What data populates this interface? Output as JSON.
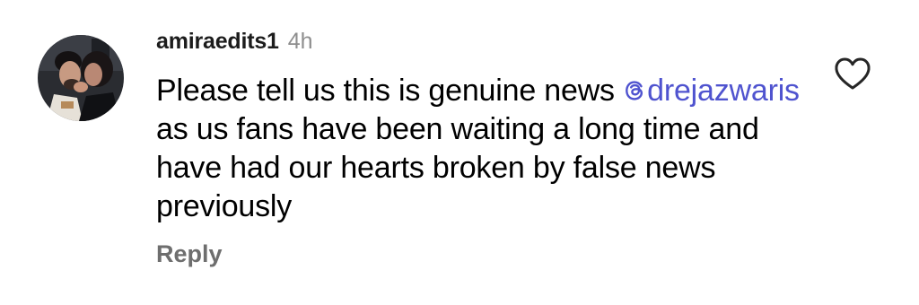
{
  "comment": {
    "username": "amiraedits1",
    "time": "4h",
    "text_before_mention": "Please tell us this is genuine news ",
    "mention": "drejazwaris",
    "text_after_mention": " as us fans have been waiting a long time and have had our hearts broken by false news previously",
    "reply_label": "Reply",
    "avatar_icon": "avatar",
    "like_icon": "heart-outline-icon",
    "mention_icon": "threads-at-icon"
  },
  "colors": {
    "mention": "#4f53cf",
    "time": "#8e8e8e",
    "reply": "#6e6e6e",
    "username": "#1c1c1c"
  }
}
